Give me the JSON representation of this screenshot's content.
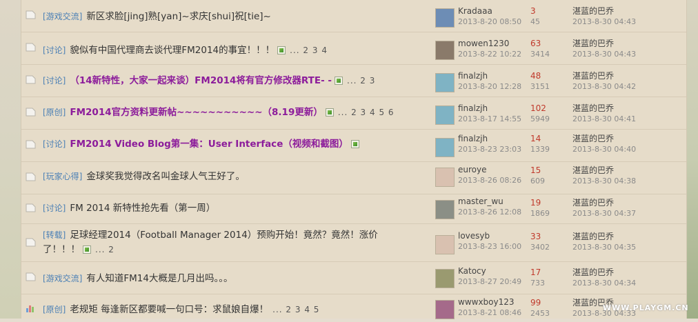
{
  "rows": [
    {
      "category": "[游戏交流]",
      "title": "新区求脸[jing]熟[yan]~求庆[shui]祝[tie]~",
      "highlight": false,
      "attachment": false,
      "pages": "",
      "author": "Kradaaa",
      "date": "2013-8-20 08:50",
      "replies": "3",
      "views": "45",
      "last_by": "湛蓝的巴乔",
      "last_date": "2013-8-30 04:43",
      "icon": "folder-icon",
      "avatar_color": "#6d8db5"
    },
    {
      "category": "[讨论]",
      "title": "貌似有中国代理商去谈代理FM2014的事宜！！！",
      "highlight": false,
      "attachment": true,
      "pages": "... 2 3 4",
      "author": "mowen1230",
      "date": "2013-8-22 10:22",
      "replies": "63",
      "views": "3414",
      "last_by": "湛蓝的巴乔",
      "last_date": "2013-8-30 04:43",
      "icon": "folder-icon",
      "avatar_color": "#8a7a6a"
    },
    {
      "category": "[讨论]",
      "title": "（14新特性，大家一起来谈）FM2014将有官方修改器RTE- -",
      "highlight": true,
      "attachment": true,
      "pages": "... 2 3",
      "author": "finalzjh",
      "date": "2013-8-20 12:28",
      "replies": "48",
      "views": "3151",
      "last_by": "湛蓝的巴乔",
      "last_date": "2013-8-30 04:42",
      "icon": "folder-icon",
      "avatar_color": "#7fb3c4"
    },
    {
      "category": "[原创]",
      "title": "FM2014官方资料更新帖~~~~~~~~~~~（8.19更新）",
      "highlight": true,
      "attachment": true,
      "pages": "... 2 3 4 5 6",
      "author": "finalzjh",
      "date": "2013-8-17 14:55",
      "replies": "102",
      "views": "5949",
      "last_by": "湛蓝的巴乔",
      "last_date": "2013-8-30 04:41",
      "icon": "folder-icon",
      "avatar_color": "#7fb3c4"
    },
    {
      "category": "[讨论]",
      "title": "FM2014 Video Blog第一集：User Interface（视频和截图）",
      "highlight": true,
      "attachment": true,
      "pages": "",
      "author": "finalzjh",
      "date": "2013-8-23 23:03",
      "replies": "14",
      "views": "1339",
      "last_by": "湛蓝的巴乔",
      "last_date": "2013-8-30 04:40",
      "icon": "folder-icon",
      "avatar_color": "#7fb3c4"
    },
    {
      "category": "[玩家心得]",
      "title": "金球奖我觉得改名叫金球人气王好了。",
      "highlight": false,
      "attachment": false,
      "pages": "",
      "author": "euroye",
      "date": "2013-8-26 08:26",
      "replies": "15",
      "views": "609",
      "last_by": "湛蓝的巴乔",
      "last_date": "2013-8-30 04:38",
      "icon": "folder-icon",
      "avatar_color": "#d9c1b0"
    },
    {
      "category": "[讨论]",
      "title": "FM 2014 新特性抢先看（第一周）",
      "highlight": false,
      "attachment": false,
      "pages": "",
      "author": "master_wu",
      "date": "2013-8-26 12:08",
      "replies": "19",
      "views": "1869",
      "last_by": "湛蓝的巴乔",
      "last_date": "2013-8-30 04:37",
      "icon": "folder-icon",
      "avatar_color": "#8b8f86"
    },
    {
      "category": "[转载]",
      "title": "足球经理2014（Football Manager 2014）预购开始！竟然？竟然！涨价了！！！",
      "highlight": false,
      "attachment": true,
      "pages": "... 2",
      "author": "lovesyb",
      "date": "2013-8-23 16:00",
      "replies": "33",
      "views": "3402",
      "last_by": "湛蓝的巴乔",
      "last_date": "2013-8-30 04:35",
      "icon": "folder-icon",
      "avatar_color": "#d9c1b0"
    },
    {
      "category": "[游戏交流]",
      "title": "有人知道FM14大概是几月出吗。。。",
      "highlight": false,
      "attachment": false,
      "pages": "",
      "author": "Katocy",
      "date": "2013-8-27 20:49",
      "replies": "17",
      "views": "733",
      "last_by": "湛蓝的巴乔",
      "last_date": "2013-8-30 04:34",
      "icon": "folder-icon",
      "avatar_color": "#9a9a70"
    },
    {
      "category": "[原创]",
      "title": "老规矩 每逢新区都要喊一句口号：求鼠娘自爆！",
      "highlight": false,
      "attachment": false,
      "pages": "... 2 3 4 5",
      "author": "wwwxboy123",
      "date": "2013-8-21 08:46",
      "replies": "99",
      "views": "2453",
      "last_by": "湛蓝的巴乔",
      "last_date": "2013-8-30 04:33",
      "icon": "poll-icon",
      "avatar_color": "#a56a8a"
    }
  ],
  "watermark": "WWW.PLAYGM.CN"
}
